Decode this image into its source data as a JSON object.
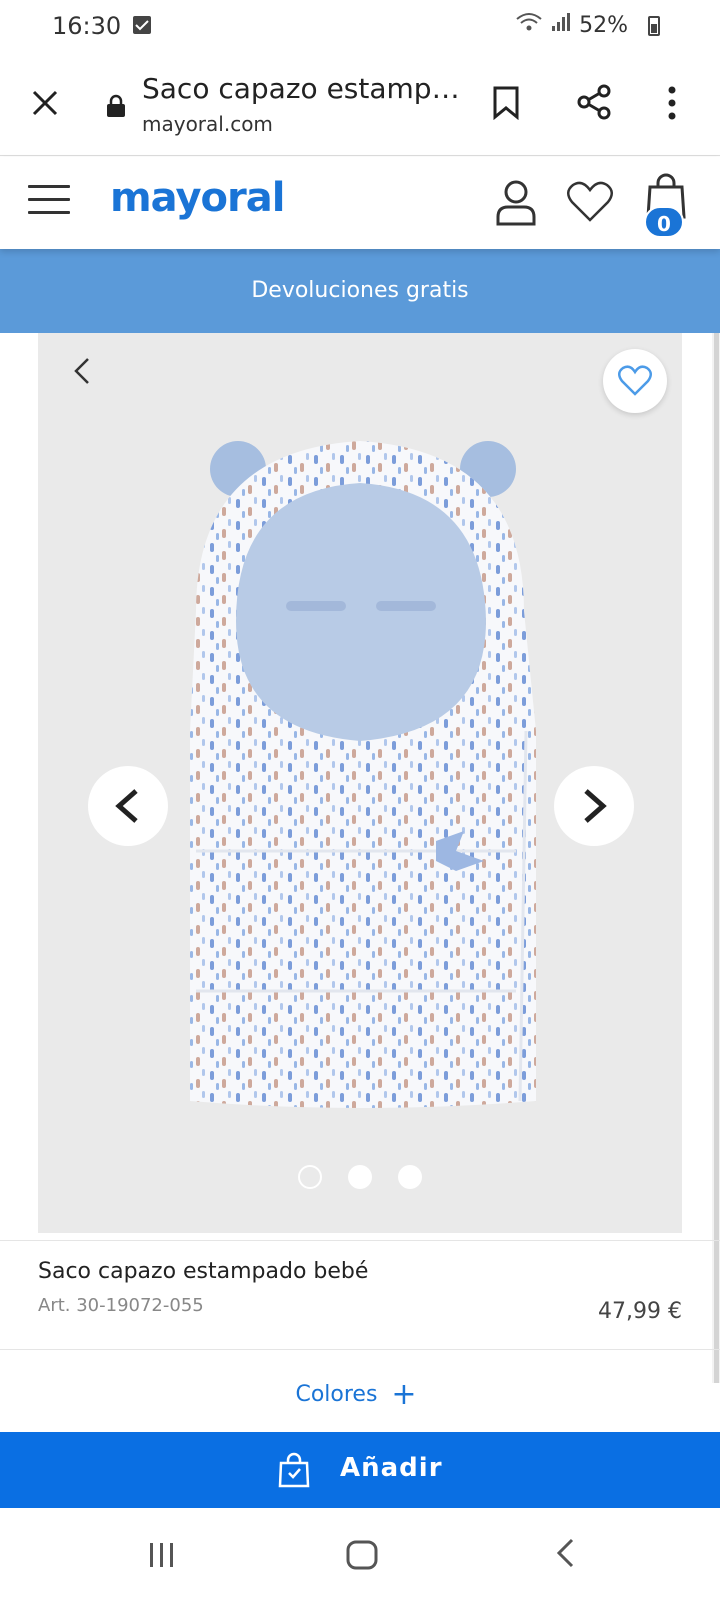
{
  "status_bar": {
    "time": "16:30",
    "battery": "52%",
    "icons": [
      "check-icon",
      "wifi-icon",
      "signal-icon",
      "battery-icon"
    ]
  },
  "browser": {
    "title": "Saco capazo estamp…",
    "url": "mayoral.com",
    "icons": [
      "close-icon",
      "lock-icon",
      "bookmark-icon",
      "share-icon",
      "more-vert-icon"
    ]
  },
  "header": {
    "logo": "mayoral",
    "cart_count": "0",
    "icons": [
      "menu-icon",
      "user-icon",
      "heart-icon",
      "bag-icon"
    ]
  },
  "promo": {
    "text": "Devoluciones gratis"
  },
  "gallery": {
    "image_count": 3,
    "active_index": 0
  },
  "product": {
    "name": "Saco capazo estampado bebé",
    "article": "Art. 30-19072-055",
    "price": "47,99 €"
  },
  "colores": {
    "label": "Colores",
    "plus": "+"
  },
  "add_button": {
    "label": "Añadir"
  },
  "colors": {
    "brand": "#1a74d6",
    "promo_bg": "#5b9ad9",
    "add_bg": "#0a6fe3",
    "gallery_bg": "#eaeaea"
  }
}
